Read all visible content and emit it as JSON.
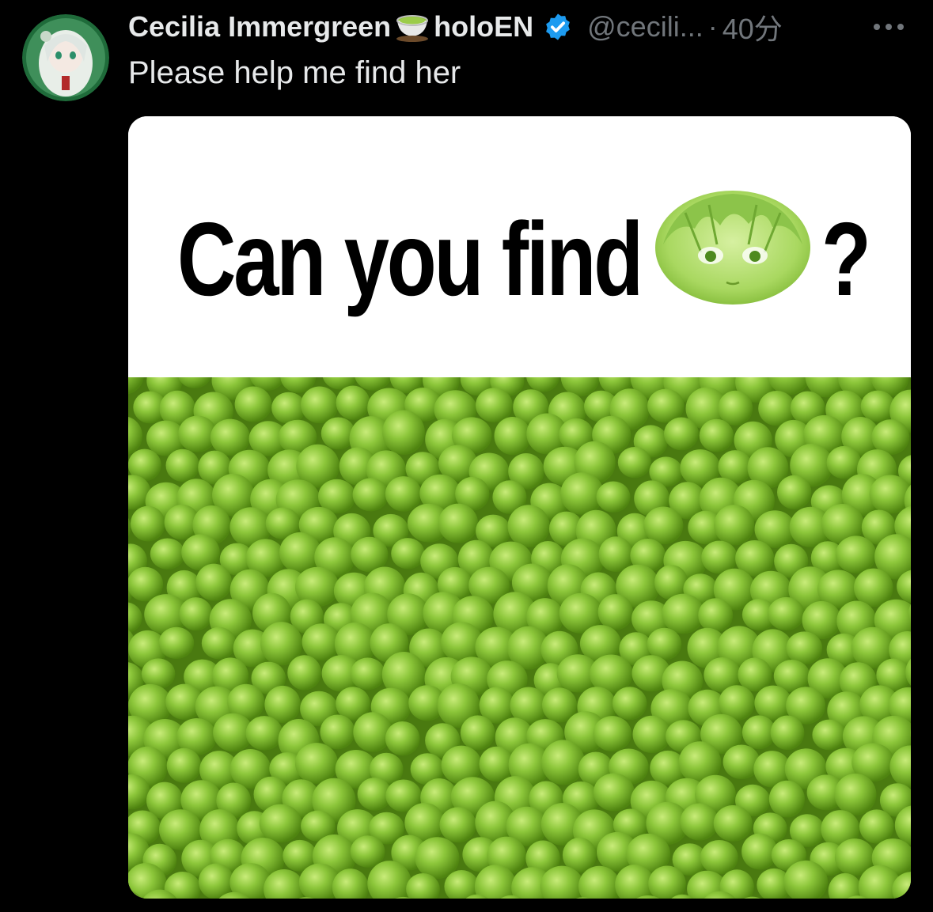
{
  "tweet": {
    "author": {
      "name": "Cecilia Immergreen",
      "name_suffix": "holoEN",
      "handle": "@cecili...",
      "verified": true
    },
    "separator": "·",
    "time": "40分",
    "text": "Please help me find her"
  },
  "media": {
    "caption": "Can you find",
    "caption_end": "?"
  },
  "icons": {
    "name_emoji": "tea-icon",
    "verified": "verified-badge-icon",
    "more": "more-horizontal-icon"
  },
  "colors": {
    "background": "#000000",
    "primary_text": "#e7e9ea",
    "secondary_text": "#71767b",
    "verified_blue": "#1d9bf0",
    "pea_green": "#7bb52a"
  }
}
